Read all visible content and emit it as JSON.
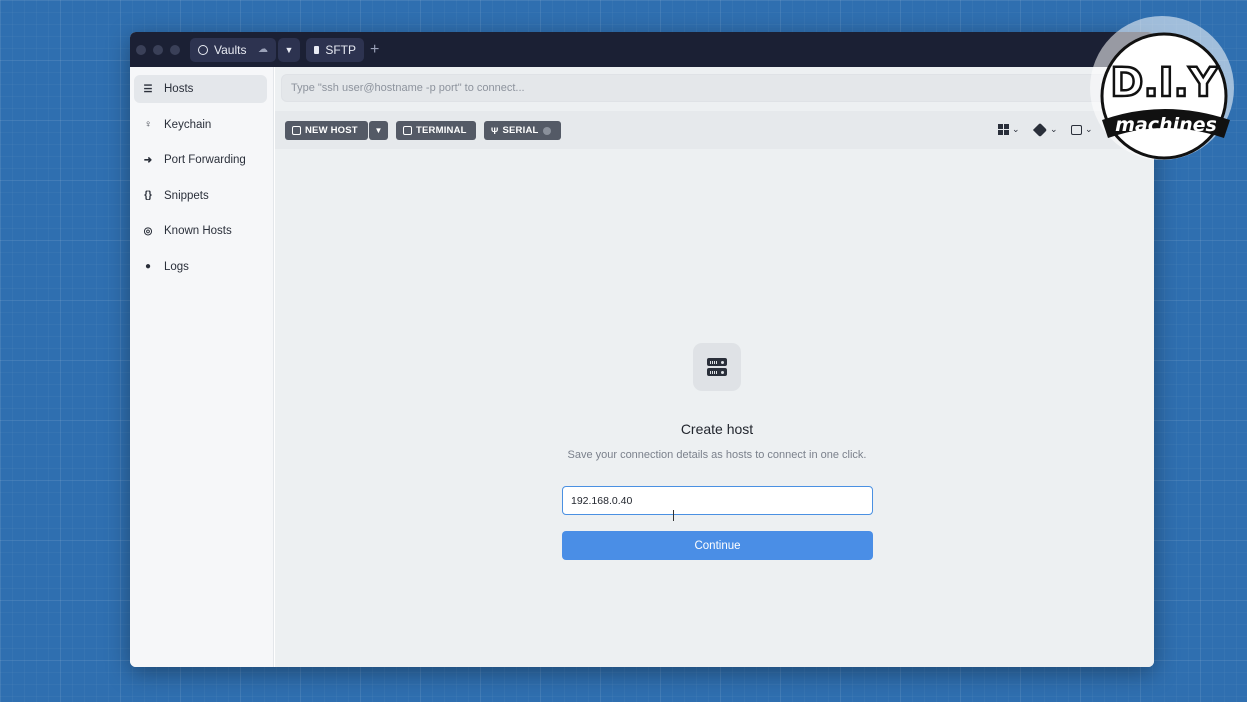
{
  "titlebar": {
    "tabs": [
      {
        "label": "Vaults",
        "icon": "vault-icon"
      },
      {
        "label": "SFTP",
        "icon": "folder-icon"
      }
    ],
    "new_tab_label": "+"
  },
  "sidebar": {
    "items": [
      {
        "label": "Hosts",
        "icon": "server-icon",
        "active": true
      },
      {
        "label": "Keychain",
        "icon": "key-icon"
      },
      {
        "label": "Port Forwarding",
        "icon": "arrow-forward-icon"
      },
      {
        "label": "Snippets",
        "icon": "braces-icon"
      },
      {
        "label": "Known Hosts",
        "icon": "fingerprint-icon"
      },
      {
        "label": "Logs",
        "icon": "clock-icon"
      }
    ]
  },
  "address_bar": {
    "placeholder": "Type \"ssh user@hostname -p port\" to connect..."
  },
  "toolbar": {
    "new_host": "NEW HOST",
    "terminal": "TERMINAL",
    "serial": "SERIAL"
  },
  "empty_state": {
    "title": "Create host",
    "subtitle": "Save your connection details as hosts to connect in one click.",
    "input_value": "192.168.0.40",
    "continue_label": "Continue"
  },
  "logo": {
    "line1": "D.I.Y",
    "line2": "machines"
  },
  "colors": {
    "accent": "#4a8ee6",
    "titlebar": "#1b2034",
    "background": "#2f6fb0"
  }
}
